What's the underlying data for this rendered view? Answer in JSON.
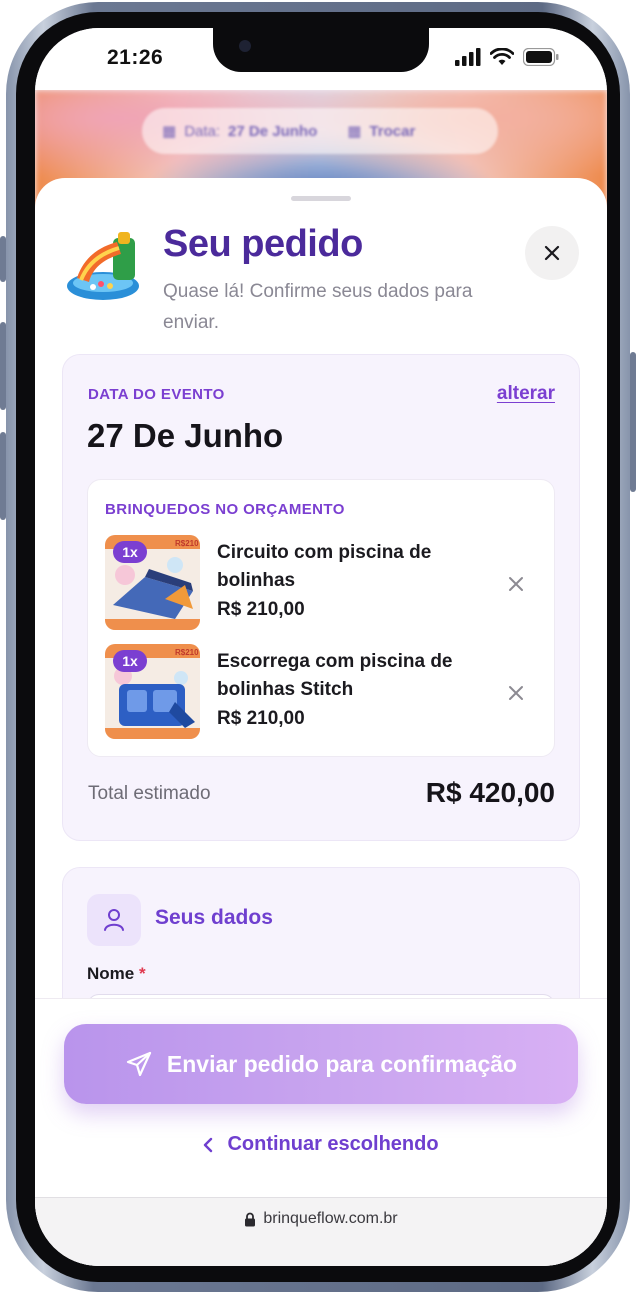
{
  "status_bar": {
    "time": "21:26",
    "icons": [
      "cellular-signal-icon",
      "wifi-icon",
      "battery-icon"
    ]
  },
  "background": {
    "date_pill": {
      "label": "Data:",
      "value": "27 De Junho",
      "action": "Trocar"
    }
  },
  "sheet": {
    "title": "Seu pedido",
    "subtitle": "Quase lá! Confirme seus dados para enviar.",
    "close_icon": "close-icon"
  },
  "event": {
    "label": "DATA DO EVENTO",
    "change_label": "alterar",
    "date": "27 De Junho"
  },
  "toys": {
    "label": "BRINQUEDOS NO ORÇAMENTO",
    "items": [
      {
        "qty": "1x",
        "name": "Circuito com piscina de bolinhas",
        "price": "R$ 210,00"
      },
      {
        "qty": "1x",
        "name": "Escorrega com piscina de bolinhas Stitch",
        "price": "R$ 210,00"
      }
    ]
  },
  "total": {
    "label": "Total estimado",
    "value": "R$ 420,00"
  },
  "customer": {
    "title": "Seus dados",
    "name_label": "Nome",
    "required_mark": "*",
    "name_value": ""
  },
  "footer": {
    "send_label": "Enviar pedido para confirmação",
    "continue_label": "Continuar escolhendo"
  },
  "browser": {
    "url": "brinqueflow.com.br"
  },
  "colors": {
    "brand_purple": "#4b2a9b",
    "accent_purple": "#7b3fd1",
    "send_button": "#c9a5ef",
    "required": "#e0394f"
  }
}
